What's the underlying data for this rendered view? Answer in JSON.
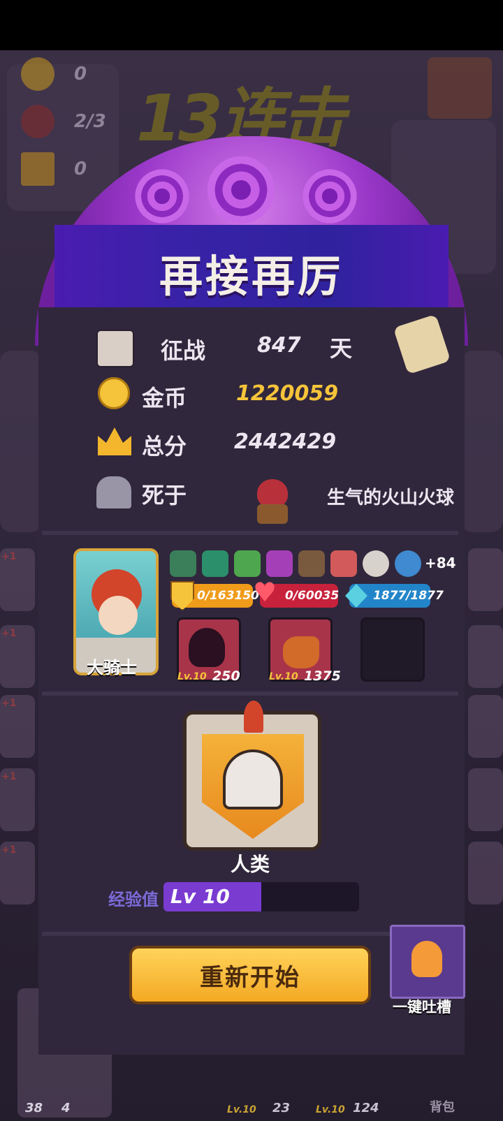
{
  "background": {
    "hud": [
      {
        "icon": "coin-icon",
        "value": "0"
      },
      {
        "icon": "devil-icon",
        "value": "2/3"
      },
      {
        "icon": "crown-icon",
        "value": "0"
      }
    ],
    "combo_text": "13连击",
    "plus_badge": "+1",
    "bottom_counts": [
      "38",
      "4"
    ],
    "bottom_skills": [
      {
        "level": "Lv.10",
        "value": "23"
      },
      {
        "level": "Lv.10",
        "value": "124"
      }
    ],
    "backpack_label": "背包"
  },
  "result": {
    "title": "再接再厉",
    "stats": {
      "days_label": "征战",
      "days_value": "847",
      "days_unit": "天",
      "coins_label": "金币",
      "coins_value": "1220059",
      "score_label": "总分",
      "score_value": "2442429",
      "death_label": "死于",
      "killer_name": "生气的火山火球"
    },
    "hero": {
      "name": "大骑士",
      "relics": [
        "trident-icon",
        "armor-icon",
        "horn-icon",
        "gear-icon",
        "axe-icon",
        "pig-icon",
        "cross-shield-icon",
        "round-shield-icon"
      ],
      "relics_more": "+84",
      "shield": "0/163150",
      "hp": "0/60035",
      "mana": "1877/1877",
      "skills": [
        {
          "icon": "shadow-skull-icon",
          "level": "Lv.10",
          "value": "250"
        },
        {
          "icon": "fire-horn-icon",
          "level": "Lv.10",
          "value": "1375"
        }
      ]
    },
    "race": {
      "name": "人类",
      "exp_label": "经验值",
      "level_text": "Lv 10",
      "exp_progress": 0.5
    },
    "restart_label": "重新开始",
    "feedback_label": "一键吐槽"
  },
  "colors": {
    "coin": "#f6c43a",
    "hp": "#c8213c",
    "shield": "#f09b1a",
    "mana": "#2385c9",
    "exp": "#7a3bd1"
  }
}
